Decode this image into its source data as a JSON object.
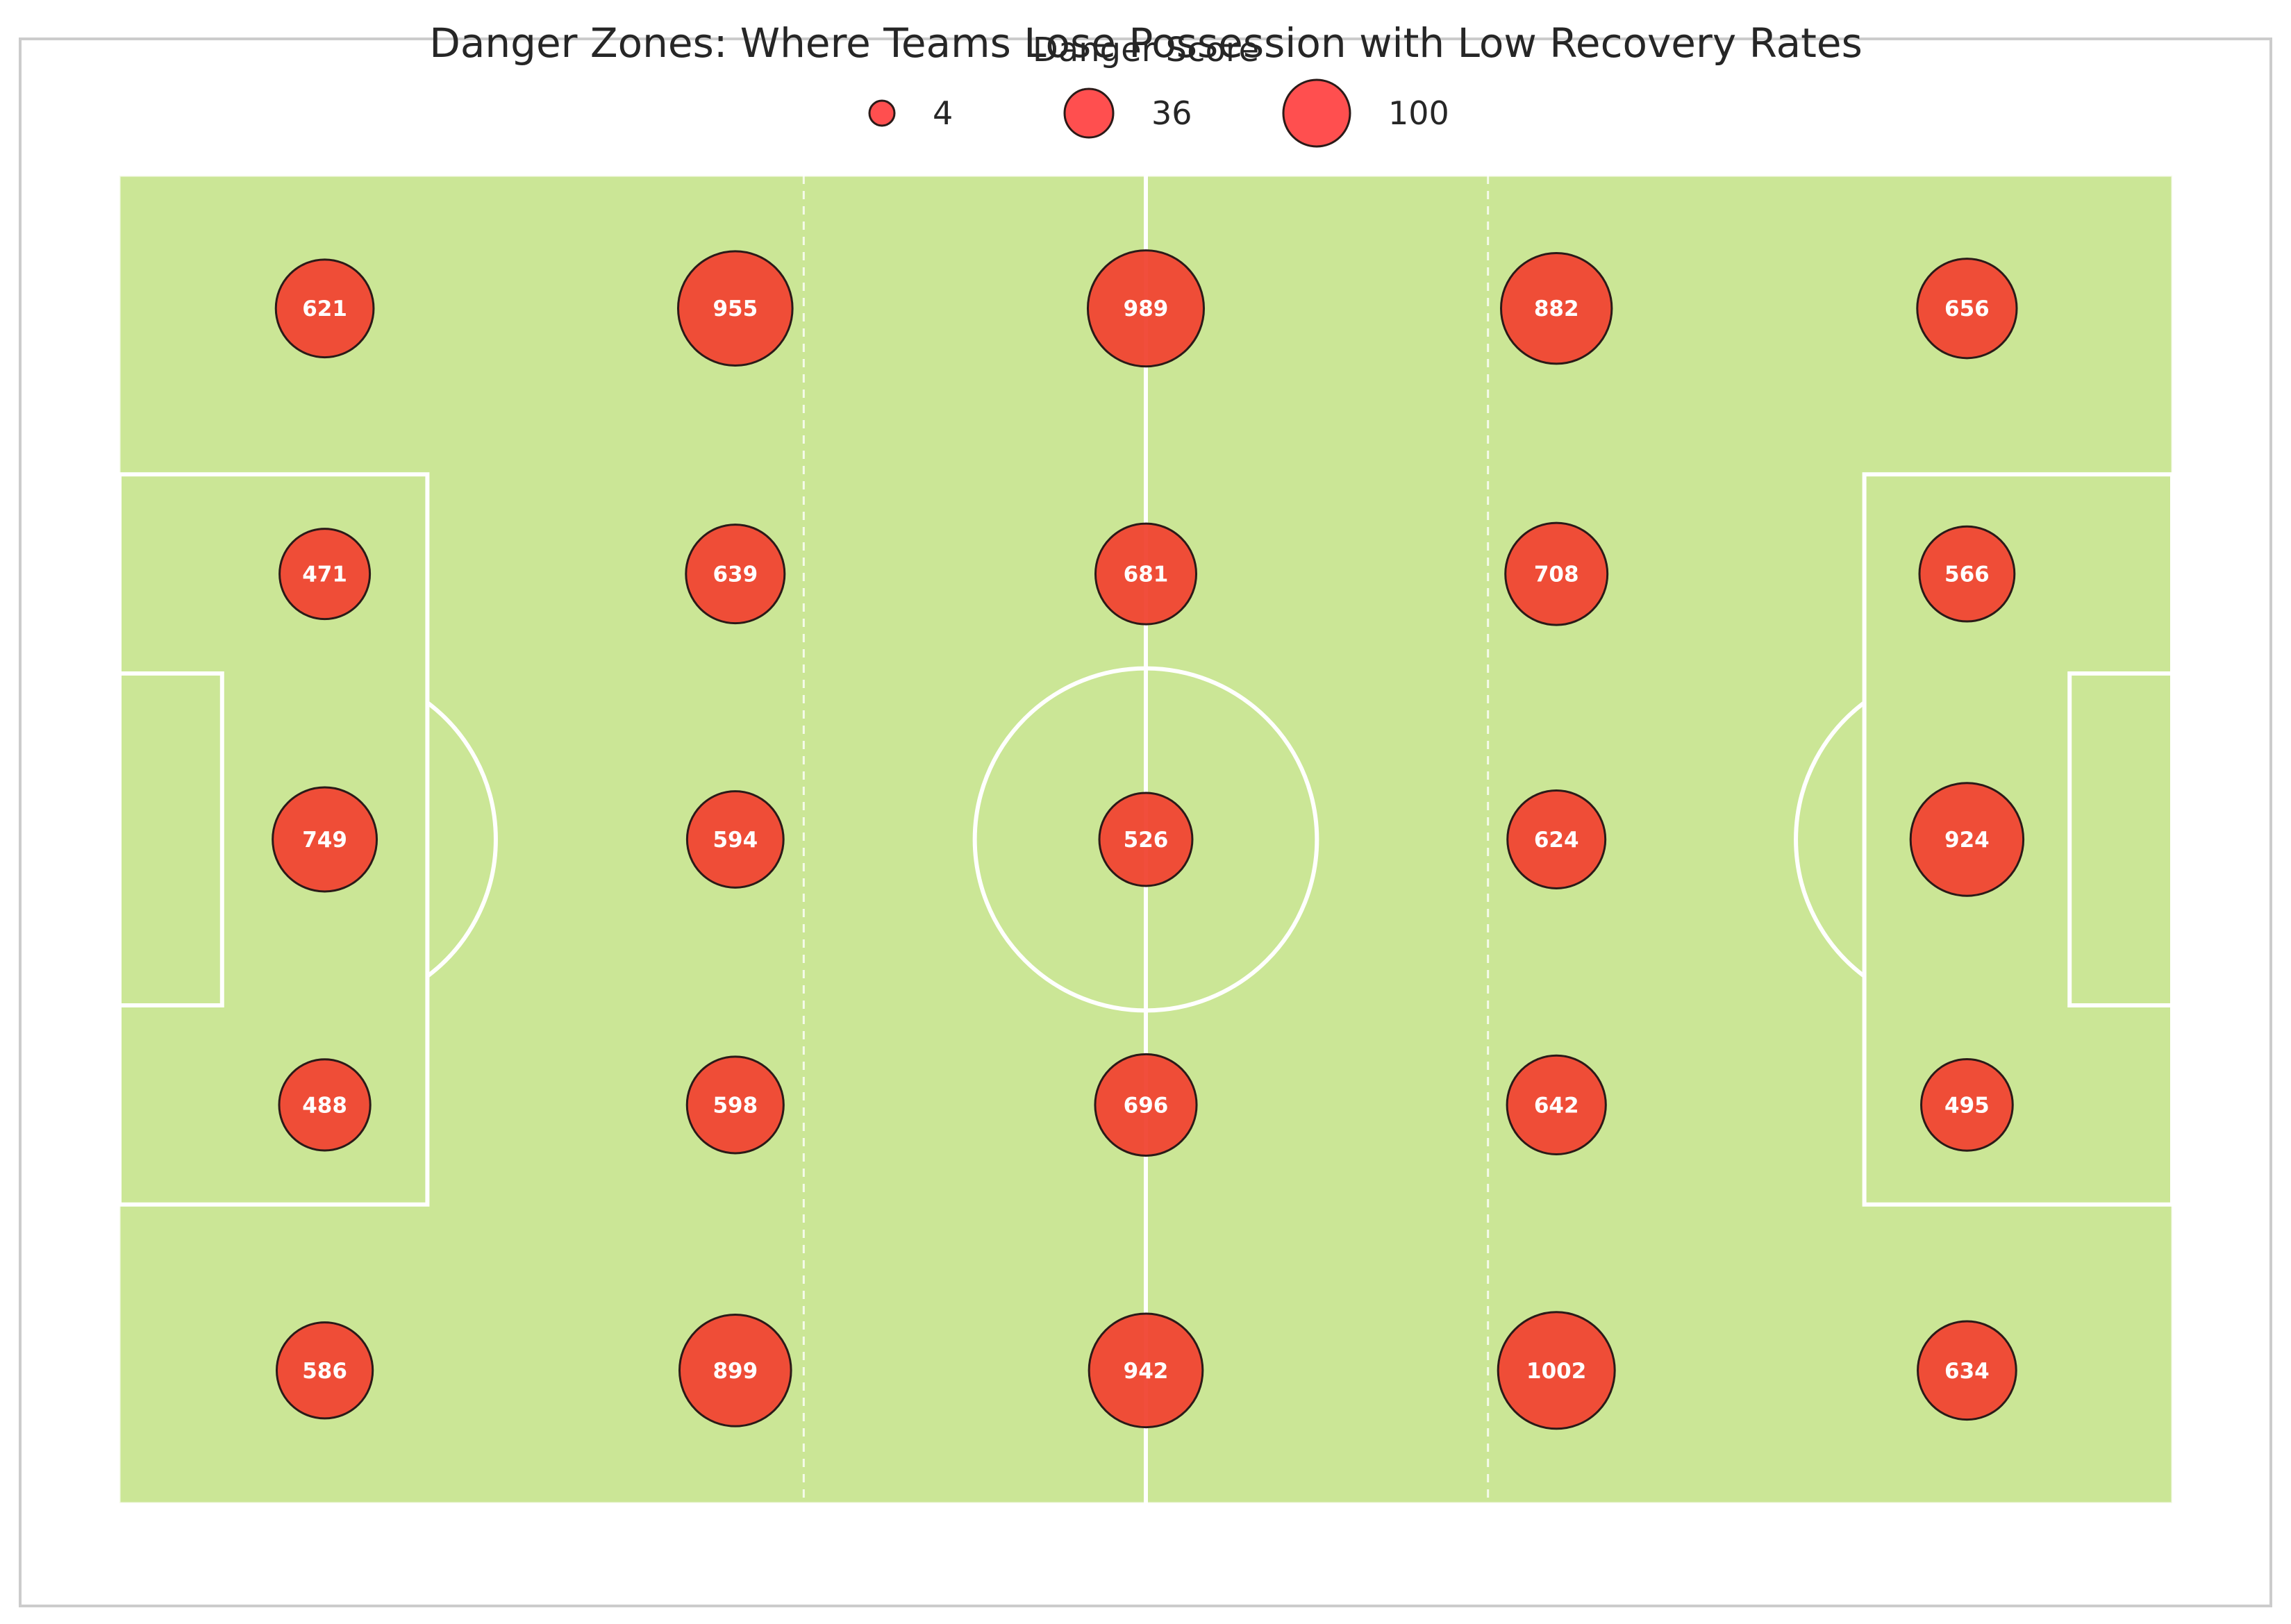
{
  "chart_data": {
    "type": "scatter",
    "title": "Danger Zones: Where Teams Lose Possession with Low Recovery Rates",
    "xlabel": "",
    "ylabel": "",
    "xlim": [
      0,
      120
    ],
    "ylim": [
      0,
      80
    ],
    "grid": false,
    "legend": {
      "title": "Danger Score",
      "placement": "top-center",
      "entries": [
        {
          "label": "4",
          "size": 4
        },
        {
          "label": "36",
          "size": 36
        },
        {
          "label": "100",
          "size": 100
        }
      ]
    },
    "points": [
      {
        "x": 12,
        "y": 72,
        "label": "621"
      },
      {
        "x": 36,
        "y": 72,
        "label": "955"
      },
      {
        "x": 60,
        "y": 72,
        "label": "989"
      },
      {
        "x": 84,
        "y": 72,
        "label": "882"
      },
      {
        "x": 108,
        "y": 72,
        "label": "656"
      },
      {
        "x": 12,
        "y": 56,
        "label": "471"
      },
      {
        "x": 36,
        "y": 56,
        "label": "639"
      },
      {
        "x": 60,
        "y": 56,
        "label": "681"
      },
      {
        "x": 84,
        "y": 56,
        "label": "708"
      },
      {
        "x": 108,
        "y": 56,
        "label": "566"
      },
      {
        "x": 12,
        "y": 40,
        "label": "749"
      },
      {
        "x": 36,
        "y": 40,
        "label": "594"
      },
      {
        "x": 60,
        "y": 40,
        "label": "526"
      },
      {
        "x": 84,
        "y": 40,
        "label": "624"
      },
      {
        "x": 108,
        "y": 40,
        "label": "924"
      },
      {
        "x": 12,
        "y": 24,
        "label": "488"
      },
      {
        "x": 36,
        "y": 24,
        "label": "598"
      },
      {
        "x": 60,
        "y": 24,
        "label": "696"
      },
      {
        "x": 84,
        "y": 24,
        "label": "642"
      },
      {
        "x": 108,
        "y": 24,
        "label": "495"
      },
      {
        "x": 12,
        "y": 8,
        "label": "586"
      },
      {
        "x": 36,
        "y": 8,
        "label": "899"
      },
      {
        "x": 60,
        "y": 8,
        "label": "942"
      },
      {
        "x": 84,
        "y": 8,
        "label": "1002"
      },
      {
        "x": 108,
        "y": 8,
        "label": "634"
      }
    ]
  },
  "colors": {
    "pitch": "#cbe696",
    "lines": "#ffffff",
    "marker_fill": "#f04532",
    "marker_edge": "#2b1a18",
    "legend_marker_fill": "#ff4f4f",
    "frame": "#cccccc"
  }
}
